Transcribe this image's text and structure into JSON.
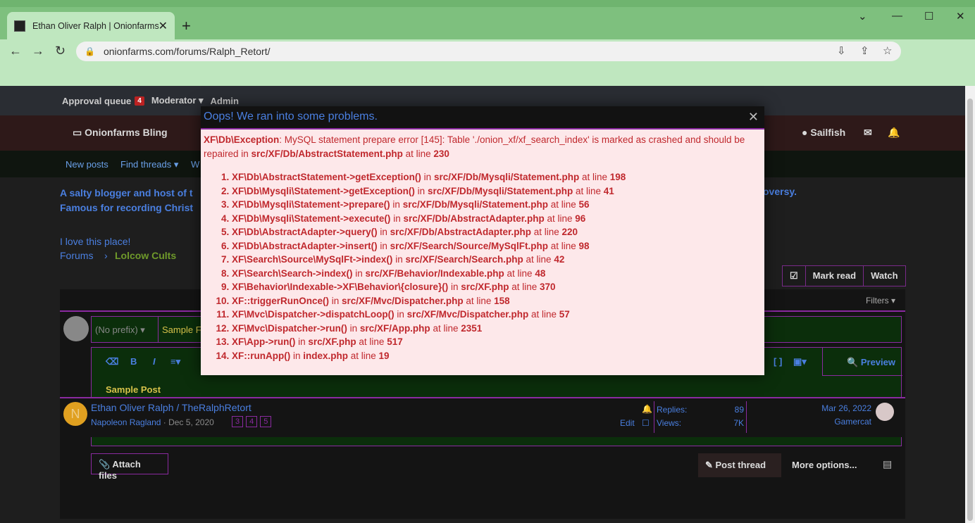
{
  "browser": {
    "tab_title": "Ethan Oliver Ralph | Onionfarms",
    "url": "onionfarms.com/forums/Ralph_Retort/"
  },
  "staffbar": {
    "approval": "Approval queue",
    "approval_count": "4",
    "moderator": "Moderator ▾",
    "admin": "Admin"
  },
  "navbar": {
    "bling": "Onionfarms Bling",
    "user": "Sailfish"
  },
  "subnav": {
    "new_posts": "New posts",
    "find_threads": "Find threads ▾",
    "w": "W"
  },
  "forum": {
    "desc_line1": "A salty blogger and host of t",
    "desc_line2": "Famous for recording Christ",
    "desc_right": "oversy.",
    "crumb_top": "I love this place!",
    "crumb_forums": "Forums",
    "crumb_sep": "›",
    "crumb_current": "Lolcow Cults",
    "mark_read": "Mark read",
    "watch": "Watch",
    "filters": "Filters ▾"
  },
  "composer": {
    "prefix": "(No prefix) ▾",
    "title_value": "Sample F",
    "body_text": "Sample Post",
    "preview": "Preview",
    "attach": "Attach files",
    "post_thread": "Post thread",
    "more_options": "More options..."
  },
  "thread_row": {
    "avatar_letter": "N",
    "title": "Ethan Oliver Ralph / TheRalphRetort",
    "author": "Napoleon Ragland",
    "date": "· Dec 5, 2020",
    "pages": [
      "3",
      "4",
      "5"
    ],
    "edit": "Edit",
    "replies_label": "Replies:",
    "replies": "89",
    "views_label": "Views:",
    "views": "7K",
    "last_date": "Mar 26, 2022",
    "last_user": "Gamercat"
  },
  "error": {
    "title": "Oops! We ran into some problems.",
    "exception": "XF\\Db\\Exception",
    "message": ": MySQL statement prepare error [145]: Table './onion_xf/xf_search_index' is marked as crashed and should be repaired in ",
    "file": "src/XF/Db/AbstractStatement.php",
    "at_line": " at line ",
    "line": "230",
    "trace": [
      {
        "call": "XF\\Db\\AbstractStatement->getException()",
        "file": "src/XF/Db/Mysqli/Statement.php",
        "line": "198"
      },
      {
        "call": "XF\\Db\\Mysqli\\Statement->getException()",
        "file": "src/XF/Db/Mysqli/Statement.php",
        "line": "41"
      },
      {
        "call": "XF\\Db\\Mysqli\\Statement->prepare()",
        "file": "src/XF/Db/Mysqli/Statement.php",
        "line": "56"
      },
      {
        "call": "XF\\Db\\Mysqli\\Statement->execute()",
        "file": "src/XF/Db/AbstractAdapter.php",
        "line": "96"
      },
      {
        "call": "XF\\Db\\AbstractAdapter->query()",
        "file": "src/XF/Db/AbstractAdapter.php",
        "line": "220"
      },
      {
        "call": "XF\\Db\\AbstractAdapter->insert()",
        "file": "src/XF/Search/Source/MySqlFt.php",
        "line": "98"
      },
      {
        "call": "XF\\Search\\Source\\MySqlFt->index()",
        "file": "src/XF/Search/Search.php",
        "line": "42"
      },
      {
        "call": "XF\\Search\\Search->index()",
        "file": "src/XF/Behavior/Indexable.php",
        "line": "48"
      },
      {
        "call": "XF\\Behavior\\Indexable->XF\\Behavior\\{closure}()",
        "file": "src/XF.php",
        "line": "370"
      },
      {
        "call": "XF::triggerRunOnce()",
        "file": "src/XF/Mvc/Dispatcher.php",
        "line": "158"
      },
      {
        "call": "XF\\Mvc\\Dispatcher->dispatchLoop()",
        "file": "src/XF/Mvc/Dispatcher.php",
        "line": "57"
      },
      {
        "call": "XF\\Mvc\\Dispatcher->run()",
        "file": "src/XF/App.php",
        "line": "2351"
      },
      {
        "call": "XF\\App->run()",
        "file": "src/XF.php",
        "line": "517"
      },
      {
        "call": "XF::runApp()",
        "file": "index.php",
        "line": "19"
      }
    ],
    "in": " in ",
    "close_glyph": "✕"
  }
}
